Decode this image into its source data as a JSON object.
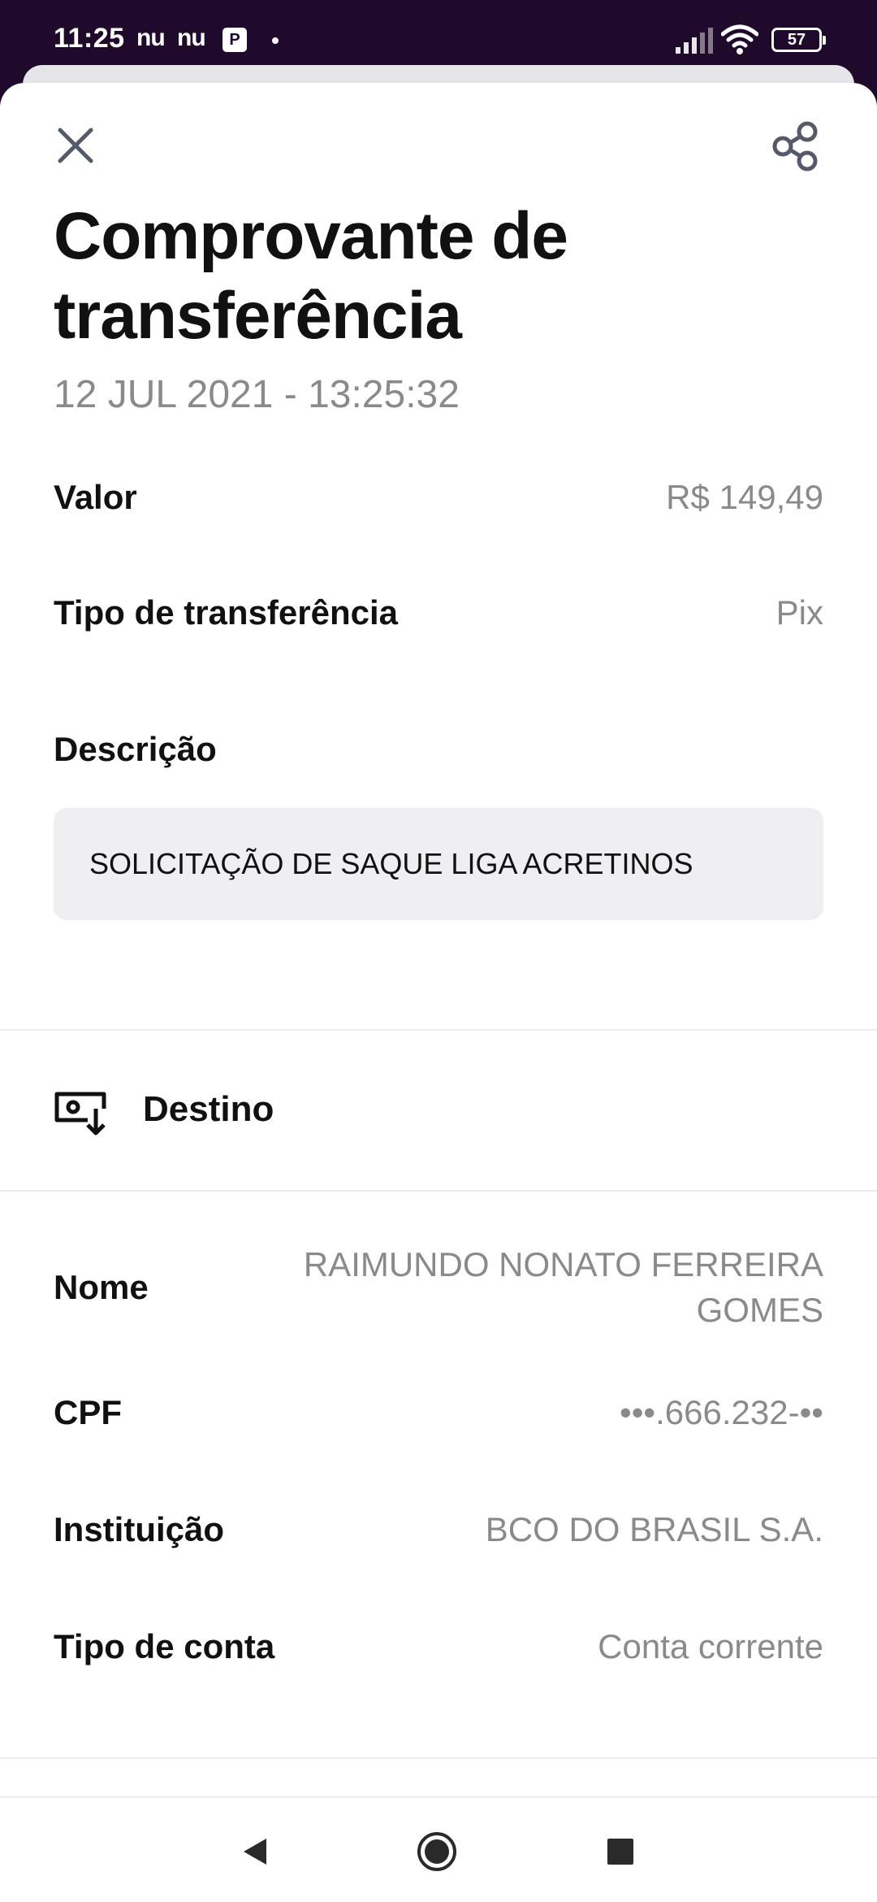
{
  "status_bar": {
    "time": "11:25",
    "app_badge_1": "nu",
    "app_badge_2": "nu",
    "parking_badge": "P",
    "battery": "57"
  },
  "header": {
    "title_line1": "Comprovante de",
    "title_line2": "transferência",
    "date": "12 JUL 2021 - 13:25:32"
  },
  "details": {
    "valor_label": "Valor",
    "valor_value": "R$ 149,49",
    "tipo_label": "Tipo de transferência",
    "tipo_value": "Pix",
    "descricao_label": "Descrição",
    "descricao_value": "SOLICITAÇÃO DE SAQUE LIGA ACRETINOS"
  },
  "destino": {
    "section_label": "Destino",
    "nome_label": "Nome",
    "nome_value_line1": "RAIMUNDO NONATO FERREIRA",
    "nome_value_line2": "GOMES",
    "cpf_label": "CPF",
    "cpf_value": "•••.666.232-••",
    "instituicao_label": "Instituição",
    "instituicao_value": "BCO DO BRASIL S.A.",
    "tipo_conta_label": "Tipo de conta",
    "tipo_conta_value": "Conta corrente"
  },
  "icons": {
    "close": "close-icon",
    "share": "share-icon",
    "destino": "receive-money-icon",
    "nav_back": "back-triangle-icon",
    "nav_home": "home-circle-icon",
    "nav_recents": "recents-square-icon"
  },
  "colors": {
    "status_bar_bg": "#1f0a2c",
    "text_primary": "#111111",
    "text_secondary": "#8a8a8a",
    "description_box_bg": "#efeff2"
  }
}
